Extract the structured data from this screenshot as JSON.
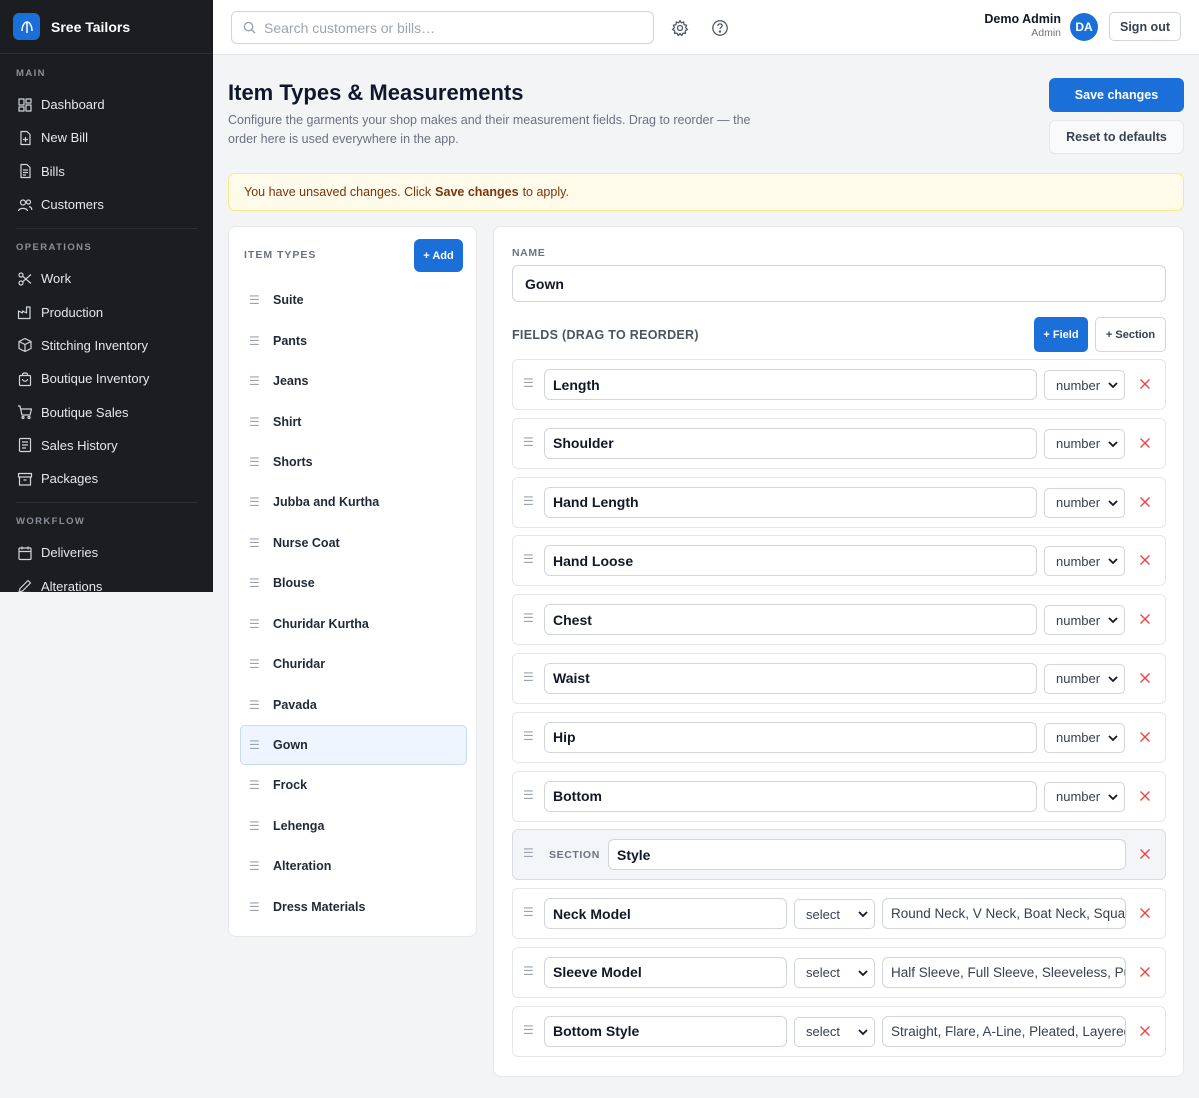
{
  "brand": {
    "name": "Sree Tailors"
  },
  "sidebar": {
    "sections": [
      {
        "title": "MAIN",
        "items": [
          {
            "label": "Dashboard",
            "icon": "dashboard-icon"
          },
          {
            "label": "New Bill",
            "icon": "new-bill-icon"
          },
          {
            "label": "Bills",
            "icon": "bills-icon"
          },
          {
            "label": "Customers",
            "icon": "customers-icon"
          }
        ]
      },
      {
        "title": "OPERATIONS",
        "items": [
          {
            "label": "Work",
            "icon": "scissors-icon"
          },
          {
            "label": "Production",
            "icon": "factory-icon"
          },
          {
            "label": "Stitching Inventory",
            "icon": "box-icon"
          },
          {
            "label": "Boutique Inventory",
            "icon": "bag-icon"
          },
          {
            "label": "Boutique Sales",
            "icon": "cart-icon"
          },
          {
            "label": "Sales History",
            "icon": "history-icon"
          },
          {
            "label": "Packages",
            "icon": "package-icon"
          }
        ]
      },
      {
        "title": "WORKFLOW",
        "items": [
          {
            "label": "Deliveries",
            "icon": "calendar-icon"
          },
          {
            "label": "Alterations",
            "icon": "pen-icon"
          }
        ]
      }
    ]
  },
  "topbar": {
    "search_placeholder": "Search customers or bills…",
    "user_name": "Demo Admin",
    "user_role": "Admin",
    "avatar_initials": "DA",
    "signout_label": "Sign out"
  },
  "page": {
    "title": "Item Types & Measurements",
    "description": "Configure the garments your shop makes and their measurement fields. Drag to reorder — the order here is used everywhere in the app.",
    "save_label": "Save changes",
    "reset_label": "Reset to defaults",
    "alert_prefix": "You have unsaved changes. Click",
    "alert_bold": "Save changes",
    "alert_suffix": "to apply."
  },
  "item_types": {
    "heading": "ITEM TYPES",
    "add_label": "+ Add",
    "items": [
      "Suite",
      "Pants",
      "Jeans",
      "Shirt",
      "Shorts",
      "Jubba and Kurtha",
      "Nurse Coat",
      "Blouse",
      "Churidar Kurtha",
      "Churidar",
      "Pavada",
      "Gown",
      "Frock",
      "Lehenga",
      "Alteration",
      "Dress Materials"
    ],
    "selected": "Gown"
  },
  "editor": {
    "name_label": "NAME",
    "name_value": "Gown",
    "fields_label": "FIELDS (DRAG TO REORDER)",
    "add_field_label": "+ Field",
    "add_section_label": "+ Section",
    "section_tag": "SECTION",
    "fields": [
      {
        "kind": "field",
        "name": "Length",
        "type": "number"
      },
      {
        "kind": "field",
        "name": "Shoulder",
        "type": "number"
      },
      {
        "kind": "field",
        "name": "Hand Length",
        "type": "number"
      },
      {
        "kind": "field",
        "name": "Hand Loose",
        "type": "number"
      },
      {
        "kind": "field",
        "name": "Chest",
        "type": "number"
      },
      {
        "kind": "field",
        "name": "Waist",
        "type": "number"
      },
      {
        "kind": "field",
        "name": "Hip",
        "type": "number"
      },
      {
        "kind": "field",
        "name": "Bottom",
        "type": "number"
      },
      {
        "kind": "section",
        "name": "Style"
      },
      {
        "kind": "field",
        "name": "Neck Model",
        "type": "select",
        "options": "Round Neck, V Neck, Boat Neck, Square Neck"
      },
      {
        "kind": "field",
        "name": "Sleeve Model",
        "type": "select",
        "options": "Half Sleeve, Full Sleeve, Sleeveless, Puff Sleeve"
      },
      {
        "kind": "field",
        "name": "Bottom Style",
        "type": "select",
        "options": "Straight, Flare, A-Line, Pleated, Layered"
      }
    ]
  },
  "colors": {
    "accent": "#1a6fd8",
    "sidebar_bg": "#1c1d21",
    "danger": "#ef4444",
    "alert_bg": "#fffbea"
  }
}
